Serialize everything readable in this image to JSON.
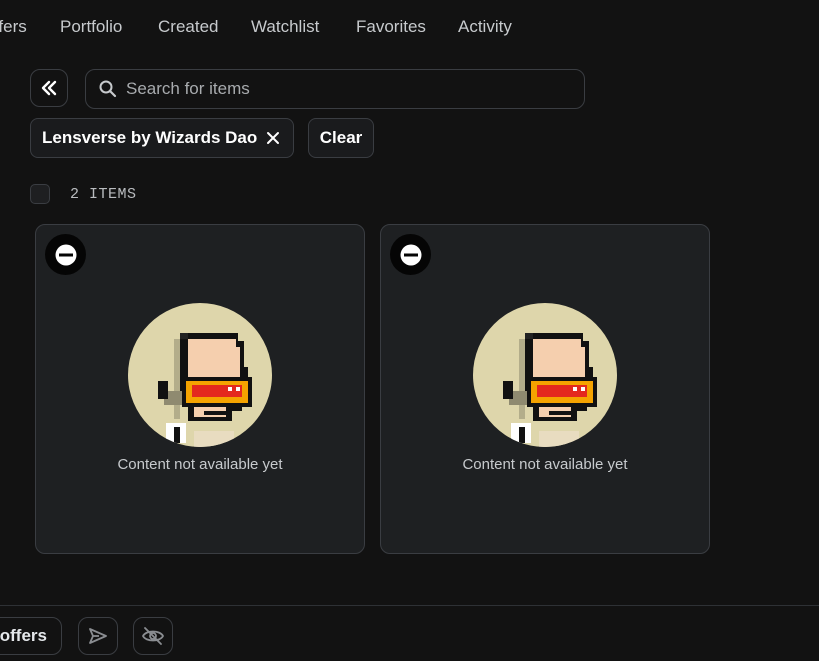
{
  "nav": {
    "tabs": [
      {
        "label": "ffers"
      },
      {
        "label": "Portfolio"
      },
      {
        "label": "Created"
      },
      {
        "label": "Watchlist"
      },
      {
        "label": "Favorites"
      },
      {
        "label": "Activity"
      }
    ]
  },
  "search": {
    "placeholder": "Search for items"
  },
  "filters": {
    "active": [
      {
        "label": "Lensverse by Wizards Dao"
      }
    ],
    "clear_label": "Clear"
  },
  "results": {
    "count_label": "2 ITEMS"
  },
  "items": [
    {
      "status_text": "Content not available yet"
    },
    {
      "status_text": "Content not available yet"
    }
  ],
  "footer": {
    "offers_label": "offers"
  },
  "icons": {
    "collapse": "double-chevron-left-icon",
    "search": "search-icon",
    "remove_filter": "close-icon",
    "badge": "minus-circle-icon",
    "send": "send-icon",
    "hide": "eye-off-icon"
  },
  "colors": {
    "background": "#121212",
    "card": "#1e2022",
    "border": "#3a3d42",
    "text": "#e5e8eb",
    "avatar_bg": "#ded6ab"
  }
}
